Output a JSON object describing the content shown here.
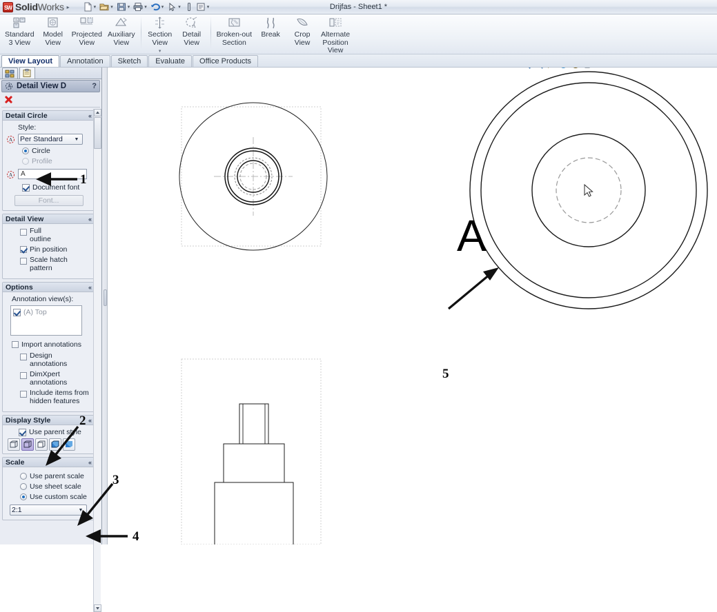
{
  "titlebar": {
    "app_name_bold": "Solid",
    "app_name_light": "Works",
    "badge": "SW",
    "menu_caret": "▸",
    "document_title": "Drijfas - Sheet1 *",
    "quick_access": [
      {
        "name": "new-document-icon",
        "caret": "▾"
      },
      {
        "name": "open-document-icon",
        "caret": "▾"
      },
      {
        "name": "save-icon",
        "caret": "▾"
      },
      {
        "name": "print-icon",
        "caret": "▾"
      },
      {
        "name": "undo-icon",
        "caret": "▾"
      },
      {
        "name": "select-arrow-icon",
        "caret": "▾"
      },
      {
        "name": "rebuild-icon",
        "caret": ""
      },
      {
        "name": "options-icon",
        "caret": "▾"
      }
    ]
  },
  "ribbon": {
    "commands": [
      {
        "label1": "Standard",
        "label2": "3 View",
        "label3": "",
        "icon": "standard-3-view-icon",
        "caret": ""
      },
      {
        "label1": "Model",
        "label2": "View",
        "label3": "",
        "icon": "model-view-icon",
        "caret": ""
      },
      {
        "label1": "Projected",
        "label2": "View",
        "label3": "",
        "icon": "projected-view-icon",
        "caret": ""
      },
      {
        "label1": "Auxiliary",
        "label2": "View",
        "label3": "",
        "icon": "auxiliary-view-icon",
        "caret": ""
      },
      {
        "label1": "Section",
        "label2": "View",
        "label3": "",
        "icon": "section-view-icon",
        "caret": "▾"
      },
      {
        "label1": "Detail",
        "label2": "View",
        "label3": "",
        "icon": "detail-view-icon",
        "caret": ""
      },
      {
        "label1": "Broken-out",
        "label2": "Section",
        "label3": "",
        "icon": "broken-out-section-icon",
        "caret": ""
      },
      {
        "label1": "Break",
        "label2": "",
        "label3": "",
        "icon": "break-icon",
        "caret": ""
      },
      {
        "label1": "Crop",
        "label2": "View",
        "label3": "",
        "icon": "crop-view-icon",
        "caret": ""
      },
      {
        "label1": "Alternate",
        "label2": "Position",
        "label3": "View",
        "icon": "alternate-position-view-icon",
        "caret": ""
      }
    ],
    "tabs": [
      {
        "label": "View Layout",
        "active": true
      },
      {
        "label": "Annotation",
        "active": false
      },
      {
        "label": "Sketch",
        "active": false
      },
      {
        "label": "Evaluate",
        "active": false
      },
      {
        "label": "Office Products",
        "active": false
      }
    ]
  },
  "property_manager": {
    "tabs": [
      {
        "name": "feature-manager-tab",
        "active": false
      },
      {
        "name": "property-manager-tab",
        "active": true
      }
    ],
    "title": "Detail View D",
    "help_glyph": "?",
    "cancel_name": "cancel-button",
    "groups": {
      "detail_circle": {
        "title": "Detail Circle",
        "collapse_glyph": "«",
        "style_label": "Style:",
        "style_value": "Per Standard",
        "style_arrow": "▼",
        "shape_options": [
          {
            "label": "Circle",
            "selected": true,
            "disabled": false
          },
          {
            "label": "Profile",
            "selected": false,
            "disabled": true
          }
        ],
        "label_value": "A",
        "document_font_label": "Document font",
        "document_font_checked": true,
        "font_button_label": "Font...",
        "font_button_disabled": true
      },
      "detail_view": {
        "title": "Detail View",
        "collapse_glyph": "«",
        "checkboxes": [
          {
            "label1": "Full",
            "label2": "outline",
            "checked": false
          },
          {
            "label1": "Pin position",
            "label2": "",
            "checked": true
          },
          {
            "label1": "Scale hatch",
            "label2": "pattern",
            "checked": false
          }
        ]
      },
      "options": {
        "title": "Options",
        "collapse_glyph": "«",
        "annotation_views_label": "Annotation view(s):",
        "annotation_items": [
          {
            "label": "(A) Top",
            "checked": true
          }
        ],
        "import_annotations_label": "Import annotations",
        "import_annotations_checked": false,
        "sub_options": [
          {
            "label1": "Design",
            "label2": "annotations",
            "checked": false
          },
          {
            "label1": "DimXpert",
            "label2": "annotations",
            "checked": false
          },
          {
            "label1": "Include items from",
            "label2": "hidden features",
            "checked": false
          }
        ]
      },
      "display_style": {
        "title": "Display Style",
        "collapse_glyph": "«",
        "use_parent_style_label": "Use parent style",
        "use_parent_style_checked": true,
        "buttons": [
          {
            "name": "wireframe-button",
            "selected": false
          },
          {
            "name": "hidden-lines-visible-button",
            "selected": true
          },
          {
            "name": "hidden-lines-removed-button",
            "selected": false
          },
          {
            "name": "shaded-with-edges-button",
            "selected": false
          },
          {
            "name": "shaded-button",
            "selected": false
          }
        ]
      },
      "scale": {
        "title": "Scale",
        "collapse_glyph": "«",
        "radios": [
          {
            "label": "Use parent scale",
            "selected": false
          },
          {
            "label": "Use sheet scale",
            "selected": false
          },
          {
            "label": "Use custom scale",
            "selected": true
          }
        ],
        "custom_scale_value": "2:1",
        "custom_scale_arrow": "▼"
      }
    }
  },
  "canvas": {
    "view_toolbar": [
      {
        "name": "zoom-to-fit-icon",
        "caret": ""
      },
      {
        "name": "zoom-to-area-icon",
        "caret": ""
      },
      {
        "name": "previous-view-icon",
        "caret": ""
      },
      {
        "name": "rebuild-view-icon",
        "caret": ""
      },
      {
        "name": "section-view-icon",
        "caret": ""
      },
      {
        "name": "display-style-icon",
        "caret": "▾"
      },
      {
        "name": "hide-show-items-icon",
        "caret": "▾"
      }
    ],
    "detail_circle_label": "A",
    "annotations": [
      {
        "number": "1",
        "target": "detail-circle-label-field"
      },
      {
        "number": "2",
        "target": "display-style-buttons"
      },
      {
        "number": "3",
        "target": "use-custom-scale-radio"
      },
      {
        "number": "4",
        "target": "custom-scale-combo"
      },
      {
        "number": "5",
        "target": "detail-view-geometry"
      }
    ]
  },
  "colors": {
    "panel_bg": "#e9ecf3",
    "panel_header": "#a8b3c8",
    "accent_blue": "#1f6fbf",
    "cancel_red": "#d81f1f",
    "selected_button": "#b6abdf",
    "canvas_bg": "#ffffff",
    "drawing_line": "#000000",
    "construction_line": "#b9b9b9"
  }
}
